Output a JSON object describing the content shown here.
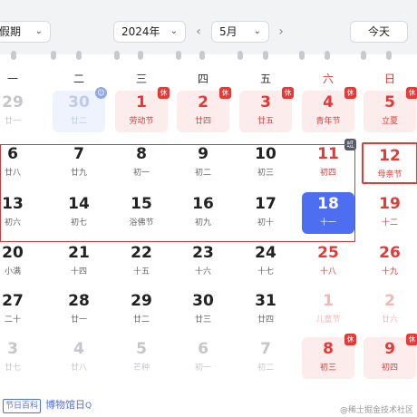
{
  "toolbar": {
    "holiday_select": "假期",
    "year_select": "2024年",
    "month_select": "5月",
    "today_button": "今天",
    "chevron": "⌄",
    "prev_arrow": "‹",
    "next_arrow": "›"
  },
  "weekdays": [
    "一",
    "二",
    "三",
    "四",
    "五",
    "六",
    "日"
  ],
  "weeks": [
    [
      {
        "day": "29",
        "lunar": "廿一",
        "type": "other"
      },
      {
        "day": "30",
        "lunar": "廿二",
        "type": "prev-holiday",
        "badge": "☺"
      },
      {
        "day": "1",
        "lunar": "劳动节",
        "type": "holiday",
        "badge": "休"
      },
      {
        "day": "2",
        "lunar": "廿四",
        "type": "holiday",
        "badge": "休"
      },
      {
        "day": "3",
        "lunar": "廿五",
        "type": "holiday",
        "badge": "休"
      },
      {
        "day": "4",
        "lunar": "青年节",
        "type": "holiday",
        "badge": "休"
      },
      {
        "day": "5",
        "lunar": "立夏",
        "type": "holiday",
        "badge": "休"
      }
    ],
    [
      {
        "day": "6",
        "lunar": "廿八",
        "type": "normal"
      },
      {
        "day": "7",
        "lunar": "廿九",
        "type": "normal"
      },
      {
        "day": "8",
        "lunar": "初一",
        "type": "normal"
      },
      {
        "day": "9",
        "lunar": "初二",
        "type": "normal"
      },
      {
        "day": "10",
        "lunar": "初三",
        "type": "normal"
      },
      {
        "day": "11",
        "lunar": "初四",
        "type": "normal",
        "badge": "班"
      },
      {
        "day": "12",
        "lunar": "母亲节",
        "type": "festival-highlight"
      }
    ],
    [
      {
        "day": "13",
        "lunar": "初六",
        "type": "normal"
      },
      {
        "day": "14",
        "lunar": "初七",
        "type": "normal"
      },
      {
        "day": "15",
        "lunar": "浴佛节",
        "type": "normal"
      },
      {
        "day": "16",
        "lunar": "初九",
        "type": "normal"
      },
      {
        "day": "17",
        "lunar": "初十",
        "type": "normal"
      },
      {
        "day": "18",
        "lunar": "十一",
        "type": "selected"
      },
      {
        "day": "19",
        "lunar": "十二",
        "type": "weekend"
      }
    ],
    [
      {
        "day": "20",
        "lunar": "小满",
        "type": "normal"
      },
      {
        "day": "21",
        "lunar": "十四",
        "type": "normal"
      },
      {
        "day": "22",
        "lunar": "十五",
        "type": "normal"
      },
      {
        "day": "23",
        "lunar": "十六",
        "type": "normal"
      },
      {
        "day": "24",
        "lunar": "十七",
        "type": "normal"
      },
      {
        "day": "25",
        "lunar": "十八",
        "type": "weekend"
      },
      {
        "day": "26",
        "lunar": "十九",
        "type": "weekend"
      }
    ],
    [
      {
        "day": "27",
        "lunar": "二十",
        "type": "normal"
      },
      {
        "day": "28",
        "lunar": "廿一",
        "type": "normal"
      },
      {
        "day": "29",
        "lunar": "廿二",
        "type": "normal"
      },
      {
        "day": "30",
        "lunar": "廿三",
        "type": "normal"
      },
      {
        "day": "31",
        "lunar": "廿四",
        "type": "normal"
      },
      {
        "day": "1",
        "lunar": "儿童节",
        "type": "other-weekend"
      },
      {
        "day": "2",
        "lunar": "廿六",
        "type": "other-weekend"
      }
    ],
    [
      {
        "day": "3",
        "lunar": "廿七",
        "type": "other"
      },
      {
        "day": "4",
        "lunar": "廿八",
        "type": "other"
      },
      {
        "day": "5",
        "lunar": "芒种",
        "type": "other"
      },
      {
        "day": "6",
        "lunar": "初一",
        "type": "other"
      },
      {
        "day": "7",
        "lunar": "初二",
        "type": "other"
      },
      {
        "day": "8",
        "lunar": "初三",
        "type": "holiday",
        "badge": "休"
      },
      {
        "day": "9",
        "lunar": "初四",
        "type": "holiday",
        "badge": "休"
      }
    ]
  ],
  "footer": {
    "tag": "节日百科",
    "link": "博物馆日",
    "link_icon": "Q",
    "watermark": "@稀土掘金技术社区"
  },
  "colors": {
    "accent": "#4e6ef2",
    "holiday_red": "#e53935",
    "holiday_bg": "#fdecec"
  }
}
